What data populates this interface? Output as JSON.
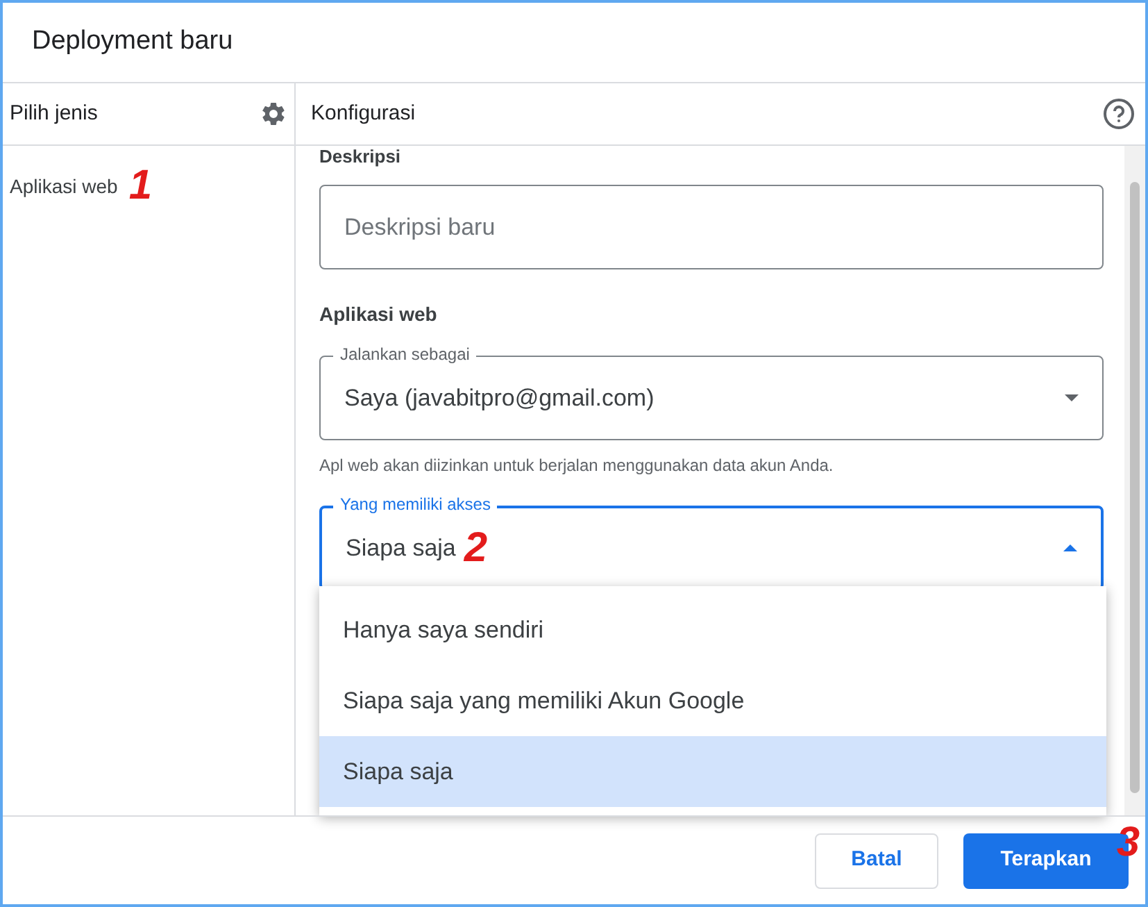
{
  "dialog": {
    "title": "Deployment baru"
  },
  "sidebar": {
    "title": "Pilih jenis",
    "items": [
      {
        "label": "Aplikasi web",
        "selected": true
      }
    ]
  },
  "config": {
    "title": "Konfigurasi",
    "description": {
      "label": "Deskripsi",
      "placeholder": "Deskripsi baru"
    },
    "section_title": "Aplikasi web",
    "fields": [
      {
        "label": "Jalankan sebagai",
        "value": "Saya (javabitpro@gmail.com)",
        "helper": "Apl web akan diizinkan untuk berjalan menggunakan data akun Anda.",
        "focused": false,
        "expanded": false
      },
      {
        "label": "Yang memiliki akses",
        "value": "Siapa saja",
        "focused": true,
        "expanded": true
      }
    ],
    "menu": [
      {
        "label": "Hanya saya sendiri",
        "selected": false
      },
      {
        "label": "Siapa saja yang memiliki Akun Google",
        "selected": false
      },
      {
        "label": "Siapa saja",
        "selected": true
      }
    ]
  },
  "buttons": [
    {
      "label": "Batal",
      "kind": "secondary"
    },
    {
      "label": "Terapkan",
      "kind": "primary"
    }
  ],
  "annotations": [
    "1",
    "2",
    "3"
  ]
}
